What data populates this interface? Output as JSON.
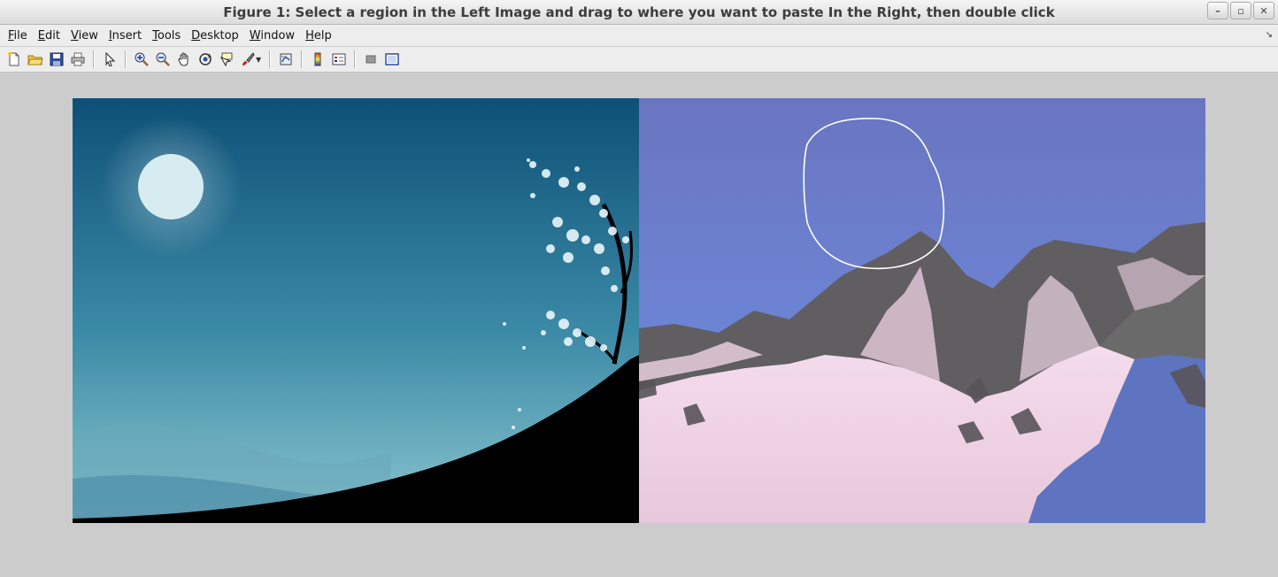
{
  "window": {
    "title": "Figure 1: Select a region in the Left Image and drag to where you want to paste In the Right, then double click",
    "controls": {
      "minimize": "–",
      "maximize": "▫",
      "close": "✕"
    }
  },
  "menubar": {
    "items": [
      "File",
      "Edit",
      "View",
      "Insert",
      "Tools",
      "Desktop",
      "Window",
      "Help"
    ],
    "dock_glyph": "↘"
  },
  "toolbar": {
    "buttons": [
      "new-figure-icon",
      "open-file-icon",
      "save-icon",
      "print-icon",
      "edit-plot-arrow-icon",
      "zoom-in-icon",
      "zoom-out-icon",
      "pan-hand-icon",
      "rotate-3d-icon",
      "data-cursor-icon",
      "brush-icon",
      "link-plot-icon",
      "insert-colorbar-icon",
      "insert-legend-icon",
      "hide-plot-tools-icon",
      "show-plot-tools-icon"
    ]
  },
  "images": {
    "left": {
      "subject": "night-sky-moon-tree-silhouette",
      "sky_top": "#0d5077",
      "sky_bottom": "#86c0cb"
    },
    "right": {
      "subject": "snowy-mountain-range",
      "sky": "#6a7fcf",
      "snow": "#f0d4e6"
    }
  }
}
